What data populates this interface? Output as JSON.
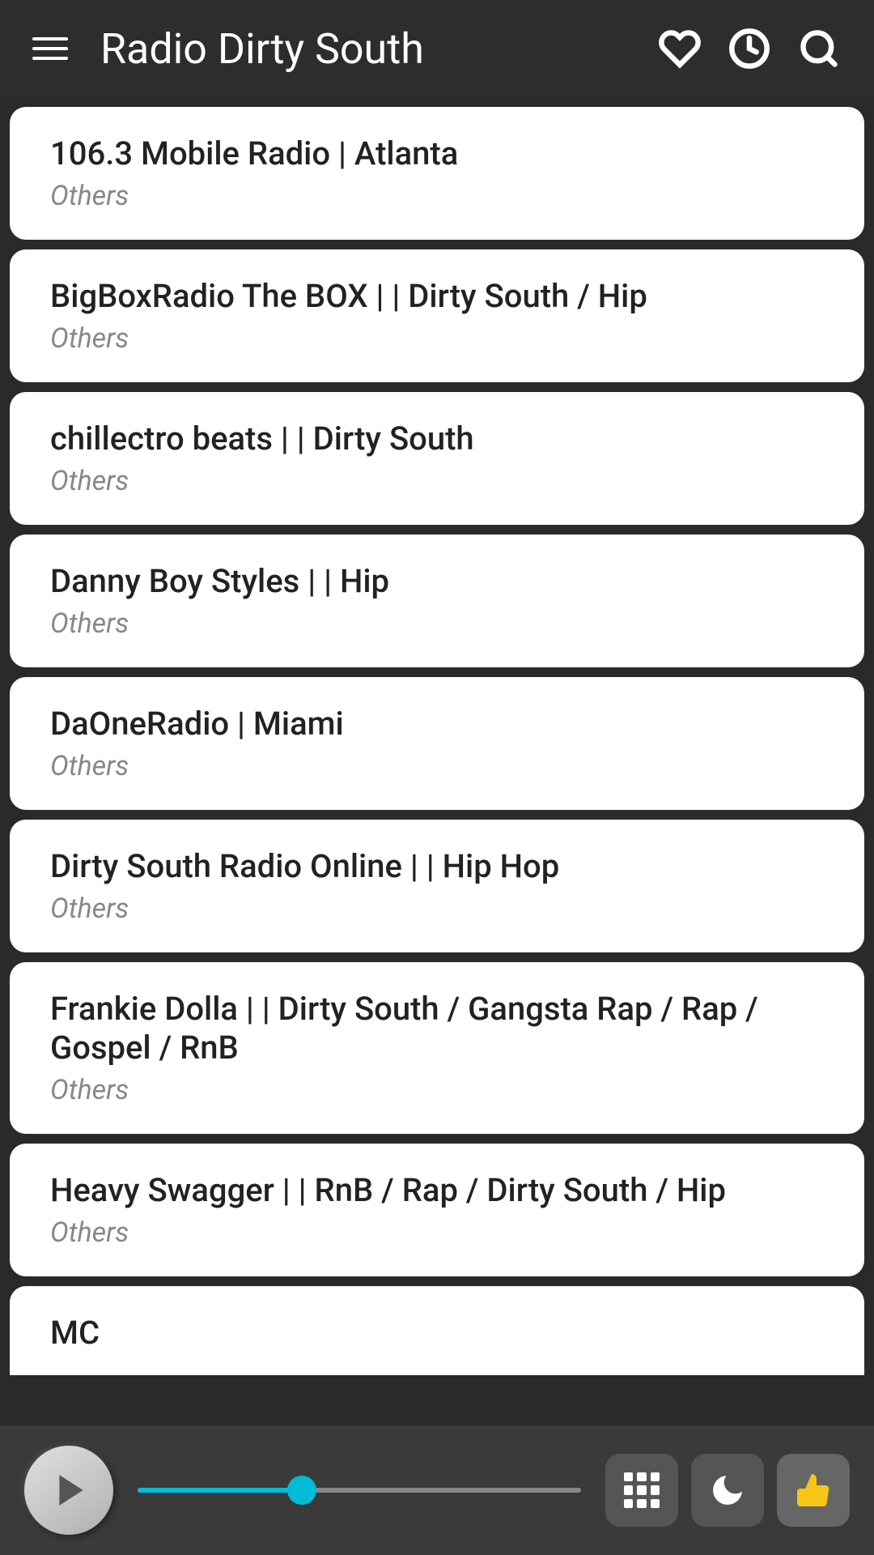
{
  "header": {
    "title": "Radio Dirty South",
    "menu_icon": "menu",
    "icons": [
      "heart",
      "clock",
      "search"
    ]
  },
  "radio_items": [
    {
      "name": "106.3 Mobile Radio | Atlanta",
      "category": "Others"
    },
    {
      "name": "BigBoxRadio The BOX | | Dirty South / Hip",
      "category": "Others"
    },
    {
      "name": "chillectro beats | | Dirty South",
      "category": "Others"
    },
    {
      "name": "Danny Boy Styles | | Hip",
      "category": "Others"
    },
    {
      "name": "DaOneRadio | Miami",
      "category": "Others"
    },
    {
      "name": "Dirty South Radio Online | | Hip Hop",
      "category": "Others"
    },
    {
      "name": "Frankie Dolla | | Dirty South / Gangsta Rap / Rap / Gospel / RnB",
      "category": "Others"
    },
    {
      "name": "Heavy Swagger | | RnB / Rap / Dirty South / Hip",
      "category": "Others"
    },
    {
      "name": "MC",
      "category": ""
    }
  ],
  "player": {
    "progress_percent": 37,
    "play_icon": "play",
    "grid_icon": "grid",
    "moon_icon": "moon",
    "thumb_icon": "thumbs-up"
  }
}
